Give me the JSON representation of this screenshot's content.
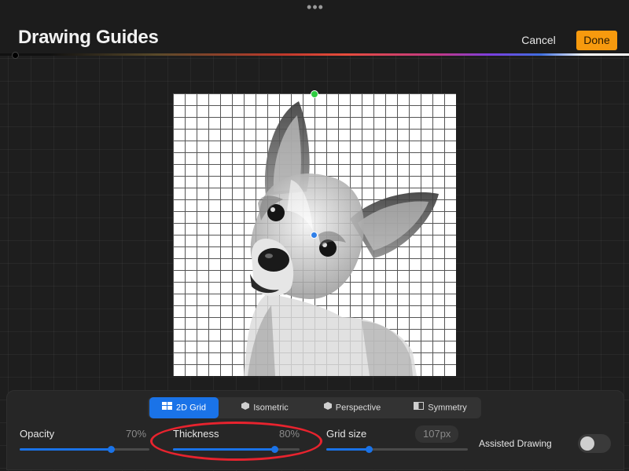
{
  "header": {
    "title": "Drawing Guides",
    "cancel_label": "Cancel",
    "done_label": "Done",
    "more_icon": "more-dots-icon",
    "accent_color": "#f79a0e"
  },
  "tabs": [
    {
      "label": "2D Grid",
      "icon": "grid-icon",
      "active": true
    },
    {
      "label": "Isometric",
      "icon": "cube-icon",
      "active": false
    },
    {
      "label": "Perspective",
      "icon": "cube-icon",
      "active": false
    },
    {
      "label": "Symmetry",
      "icon": "symmetry-icon",
      "active": false
    }
  ],
  "controls": {
    "opacity": {
      "label": "Opacity",
      "value_text": "70%",
      "level": 0.7
    },
    "thickness": {
      "label": "Thickness",
      "value_text": "80%",
      "level": 0.8
    },
    "grid_size": {
      "label": "Grid size",
      "value_text": "107px",
      "level": 0.3
    },
    "assisted_drawing": {
      "label": "Assisted Drawing",
      "on": false
    }
  },
  "colors": {
    "slider_accent": "#1a73e8",
    "annotation": "#e8232e",
    "rotation_handle": "#2ecc40"
  }
}
